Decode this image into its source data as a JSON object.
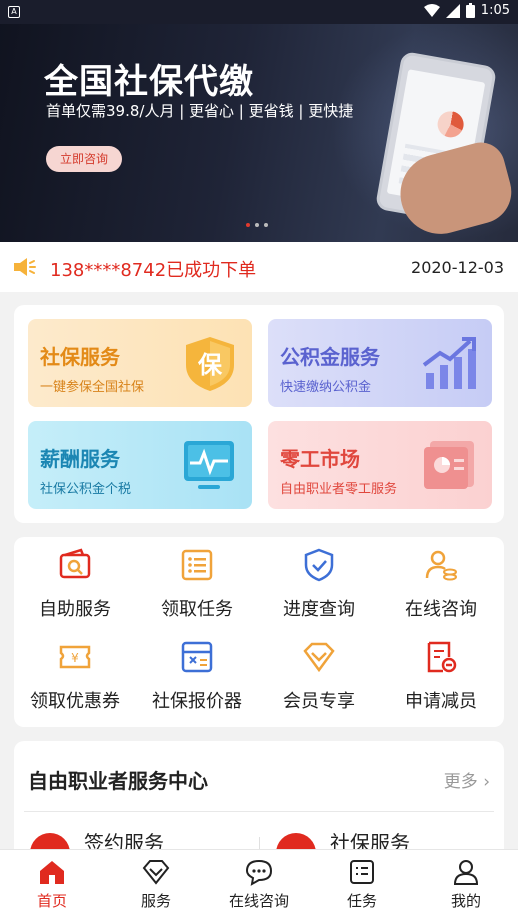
{
  "status_bar": {
    "time": "1:05"
  },
  "banner": {
    "title": "全国社保代缴",
    "subtitle": "首单仅需39.8/人月 | 更省心 | 更省钱 | 更快捷",
    "button_label": "立即咨询",
    "page_count": 3,
    "active_page": 1
  },
  "notice": {
    "message": "138****8742已成功下单",
    "date": "2020-12-03"
  },
  "services": [
    {
      "title": "社保服务",
      "subtitle": "一键参保全国社保",
      "icon": "shield-bao-icon"
    },
    {
      "title": "公积金服务",
      "subtitle": "快速缴纳公积金",
      "icon": "bar-chart-icon"
    },
    {
      "title": "薪酬服务",
      "subtitle": "社保公积金个税",
      "icon": "monitor-pulse-icon"
    },
    {
      "title": "零工市场",
      "subtitle": "自由职业者零工服务",
      "icon": "document-chart-icon"
    }
  ],
  "grid": [
    {
      "label": "自助服务",
      "icon": "wallet-search-icon"
    },
    {
      "label": "领取任务",
      "icon": "list-icon"
    },
    {
      "label": "进度查询",
      "icon": "shield-check-icon"
    },
    {
      "label": "在线咨询",
      "icon": "person-coins-icon"
    },
    {
      "label": "领取优惠券",
      "icon": "coupon-yen-icon"
    },
    {
      "label": "社保报价器",
      "icon": "calculator-icon"
    },
    {
      "label": "会员专享",
      "icon": "diamond-icon"
    },
    {
      "label": "申请减员",
      "icon": "document-minus-icon"
    }
  ],
  "center": {
    "title": "自由职业者服务中心",
    "more_label": "更多",
    "items": [
      {
        "label": "签约服务"
      },
      {
        "label": "社保服务"
      }
    ]
  },
  "tabbar": [
    {
      "label": "首页",
      "icon": "home-icon",
      "active": true
    },
    {
      "label": "服务",
      "icon": "diamond-icon",
      "active": false
    },
    {
      "label": "在线咨询",
      "icon": "chat-icon",
      "active": false
    },
    {
      "label": "任务",
      "icon": "task-list-icon",
      "active": false
    },
    {
      "label": "我的",
      "icon": "person-icon",
      "active": false
    }
  ],
  "colors": {
    "accent": "#e02a1f",
    "orange": "#f0a33a",
    "blue": "#3d6fd6"
  }
}
